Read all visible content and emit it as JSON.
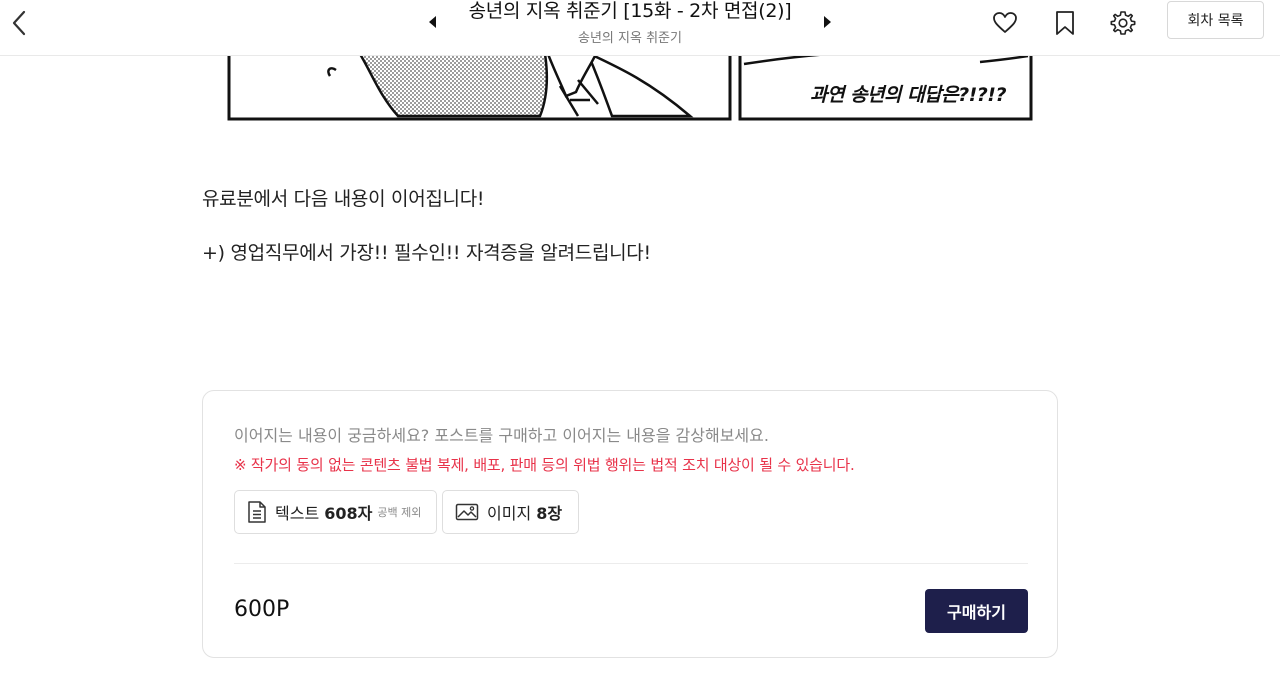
{
  "header": {
    "episode_title": "송년의 지옥 취준기 [15화 - 2차 면접(2)]",
    "series_title": "송년의 지옥 취준기",
    "episode_list_label": "회차 목록",
    "icons": [
      "back-icon",
      "prev-arrow-icon",
      "next-arrow-icon",
      "heart-icon",
      "bookmark-icon",
      "gear-icon"
    ]
  },
  "comic": {
    "bubble_text": "과연 송년의 대답은?!?!?"
  },
  "body": {
    "teaser_1": "유료분에서 다음 내용이 이어집니다!",
    "teaser_2": "+) 영업직무에서 가장!! 필수인!! 자격증을 알려드립니다!"
  },
  "purchase": {
    "info": "이어지는 내용이 궁금하세요? 포스트를 구매하고 이어지는 내용을 감상해보세요.",
    "warning": "※ 작가의 동의 없는 콘텐츠 불법 복제, 배포, 판매 등의 위법 행위는 법적 조치 대상이 될 수 있습니다.",
    "text_chip": {
      "label": "텍스트",
      "count": "608자",
      "note": "공백 제외"
    },
    "image_chip": {
      "label": "이미지",
      "count": "8장"
    },
    "price": "600P",
    "buy_label": "구매하기",
    "colors": {
      "buy_button": "#1e1f4b",
      "warning": "#e8334a"
    }
  }
}
